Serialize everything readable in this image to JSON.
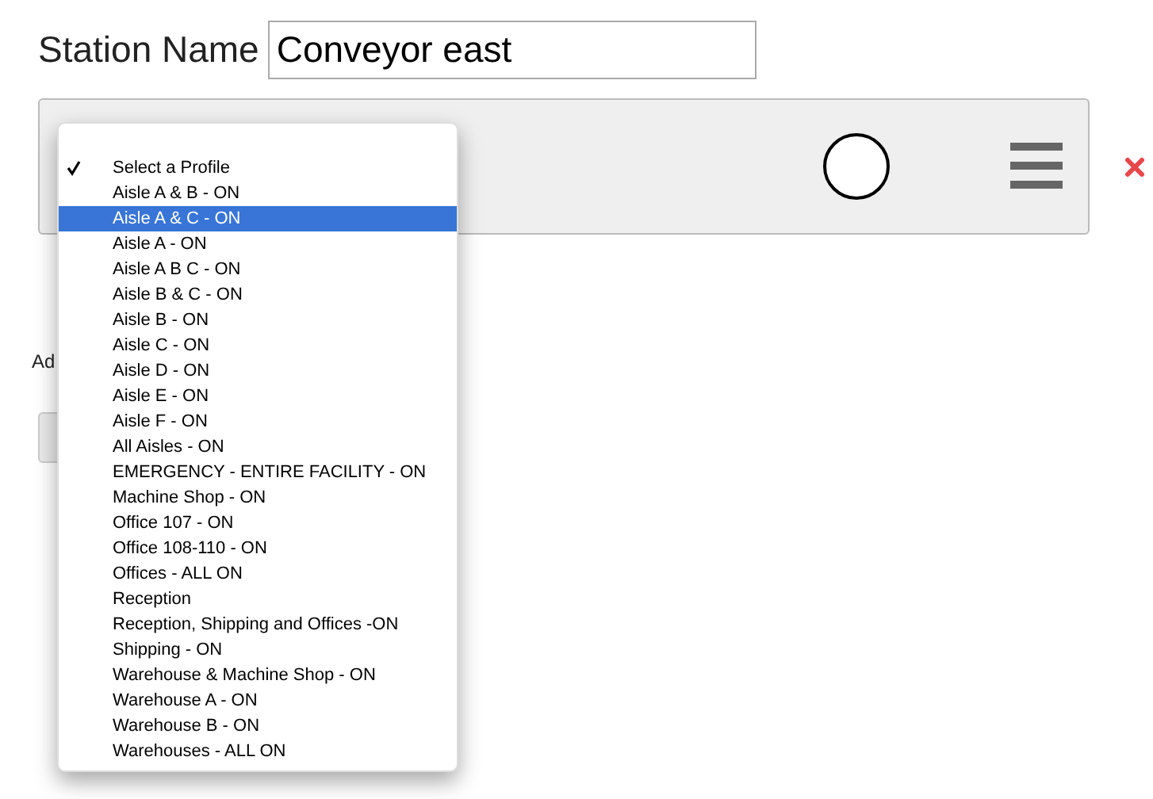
{
  "station_name": {
    "label": "Station Name",
    "value": "Conveyor east"
  },
  "partial_label": "Ad",
  "profile_menu": {
    "options": [
      {
        "label": "Select a Profile",
        "checked": true,
        "highlighted": false
      },
      {
        "label": "Aisle A & B - ON",
        "checked": false,
        "highlighted": false
      },
      {
        "label": "Aisle A & C - ON",
        "checked": false,
        "highlighted": true
      },
      {
        "label": "Aisle A - ON",
        "checked": false,
        "highlighted": false
      },
      {
        "label": "Aisle A B C - ON",
        "checked": false,
        "highlighted": false
      },
      {
        "label": "Aisle B & C - ON",
        "checked": false,
        "highlighted": false
      },
      {
        "label": "Aisle B - ON",
        "checked": false,
        "highlighted": false
      },
      {
        "label": "Aisle C - ON",
        "checked": false,
        "highlighted": false
      },
      {
        "label": "Aisle D - ON",
        "checked": false,
        "highlighted": false
      },
      {
        "label": "Aisle E - ON",
        "checked": false,
        "highlighted": false
      },
      {
        "label": "Aisle F - ON",
        "checked": false,
        "highlighted": false
      },
      {
        "label": "All Aisles - ON",
        "checked": false,
        "highlighted": false
      },
      {
        "label": "EMERGENCY - ENTIRE FACILITY - ON",
        "checked": false,
        "highlighted": false
      },
      {
        "label": "Machine Shop - ON",
        "checked": false,
        "highlighted": false
      },
      {
        "label": "Office 107 - ON",
        "checked": false,
        "highlighted": false
      },
      {
        "label": "Office 108-110 - ON",
        "checked": false,
        "highlighted": false
      },
      {
        "label": "Offices - ALL ON",
        "checked": false,
        "highlighted": false
      },
      {
        "label": "Reception",
        "checked": false,
        "highlighted": false
      },
      {
        "label": "Reception, Shipping and Offices -ON",
        "checked": false,
        "highlighted": false
      },
      {
        "label": "Shipping - ON",
        "checked": false,
        "highlighted": false
      },
      {
        "label": "Warehouse & Machine Shop - ON",
        "checked": false,
        "highlighted": false
      },
      {
        "label": "Warehouse A - ON",
        "checked": false,
        "highlighted": false
      },
      {
        "label": "Warehouse B - ON",
        "checked": false,
        "highlighted": false
      },
      {
        "label": "Warehouses - ALL ON",
        "checked": false,
        "highlighted": false
      }
    ]
  }
}
